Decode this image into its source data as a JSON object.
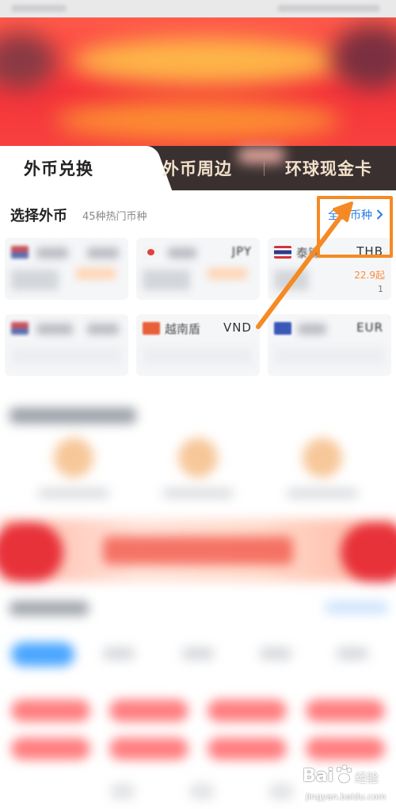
{
  "tabs": {
    "exchange": "外币兑换",
    "nearby": "外币周边",
    "global_card": "环球现金卡"
  },
  "section": {
    "title": "选择外币",
    "subtitle": "45种热门币种",
    "all_link": "全部币种"
  },
  "cards": [
    {
      "name": "",
      "code": "",
      "rate": "",
      "sub": ""
    },
    {
      "name": "",
      "code": "JPY",
      "rate": "",
      "sub": ""
    },
    {
      "name": "泰铢",
      "code": "THB",
      "rate": "22.9起",
      "sub": "1"
    },
    {
      "name": "",
      "code": "",
      "rate": "",
      "sub": ""
    },
    {
      "name": "越南盾",
      "code": "VND",
      "rate": "",
      "sub": ""
    },
    {
      "name": "",
      "code": "EUR",
      "rate": "",
      "sub": ""
    }
  ],
  "watermark": {
    "logo": "Bai",
    "cn": "经验",
    "url": "jingyan.baidu.com"
  },
  "colors": {
    "accent_blue": "#2a7de1",
    "highlight_orange": "#f58a24",
    "banner_red": "#f4343a",
    "tab_bar_dark": "#3a3030"
  }
}
